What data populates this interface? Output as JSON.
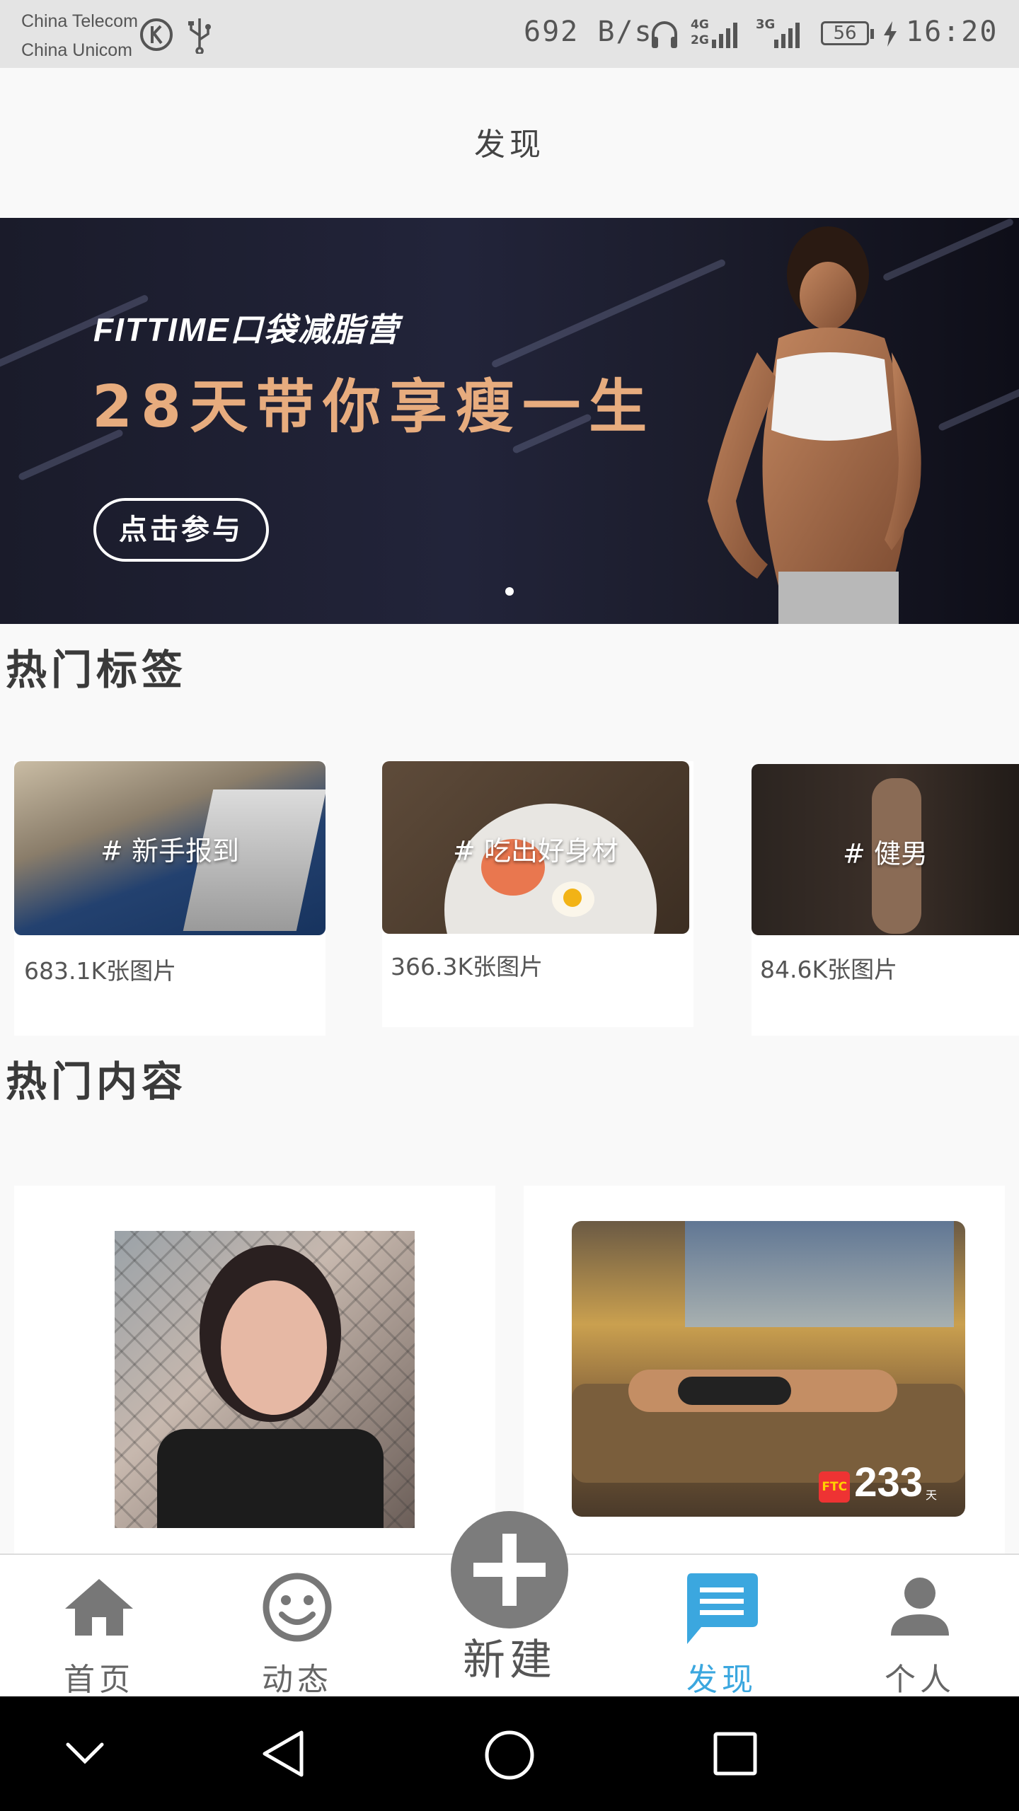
{
  "status_bar": {
    "carrier_1": "China  Telecom",
    "carrier_2": "China  Unicom",
    "net_speed": "692 B/s",
    "network_4g": "4G",
    "network_2g": "2G",
    "network_3g": "3G",
    "battery_level": "56",
    "time": "16:20"
  },
  "header": {
    "title": "发现"
  },
  "banner": {
    "brand": "FITTIME口袋减脂营",
    "slogan": "28天带你享瘦一生",
    "cta_label": "点击参与",
    "accent_color": "#e7ac7e"
  },
  "hot_tags": {
    "title": "热门标签",
    "items": [
      {
        "label": "# 新手报到",
        "count": "683.1K张图片"
      },
      {
        "label": "# 吃出好身材",
        "count": "366.3K张图片"
      },
      {
        "label": "# 健男",
        "count": "84.6K张图片"
      }
    ]
  },
  "hot_content": {
    "title": "热门内容",
    "items": [
      {
        "image": "selfie-photo"
      },
      {
        "image": "workout-photo",
        "badge_logo": "FTC",
        "badge_number": "233",
        "badge_unit": "天"
      }
    ]
  },
  "bottom_nav": {
    "items": [
      {
        "label": "首页",
        "icon": "home-icon"
      },
      {
        "label": "动态",
        "icon": "smiley-icon"
      },
      {
        "label": "新建",
        "icon": "plus-icon"
      },
      {
        "label": "发现",
        "icon": "chat-bubble-icon",
        "active": true
      },
      {
        "label": "个人",
        "icon": "person-icon"
      }
    ],
    "active_color": "#3ba7df"
  },
  "system_nav": {
    "icons": [
      "collapse-icon",
      "back-icon",
      "home-circle-icon",
      "recents-icon"
    ]
  }
}
